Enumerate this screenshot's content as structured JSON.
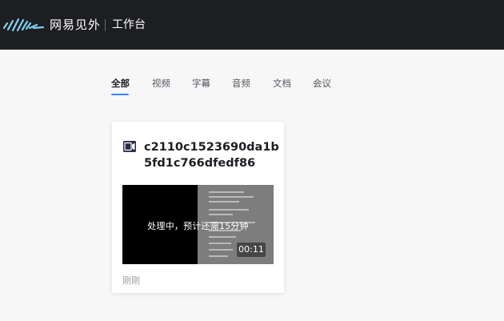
{
  "header": {
    "brand": "网易见外",
    "workspace": "工作台"
  },
  "tabs": [
    {
      "label": "全部",
      "active": true
    },
    {
      "label": "视频",
      "active": false
    },
    {
      "label": "字幕",
      "active": false
    },
    {
      "label": "音频",
      "active": false
    },
    {
      "label": "文档",
      "active": false
    },
    {
      "label": "会议",
      "active": false
    }
  ],
  "card": {
    "title": "c2110c1523690da1b5fd1c766dfedf86",
    "status": "处理中，预计还需15分钟",
    "duration": "00:11",
    "time": "刚刚"
  },
  "colors": {
    "topbar": "#1d1e22",
    "accent": "#3b82f6",
    "logo": "#6ec3e8"
  }
}
